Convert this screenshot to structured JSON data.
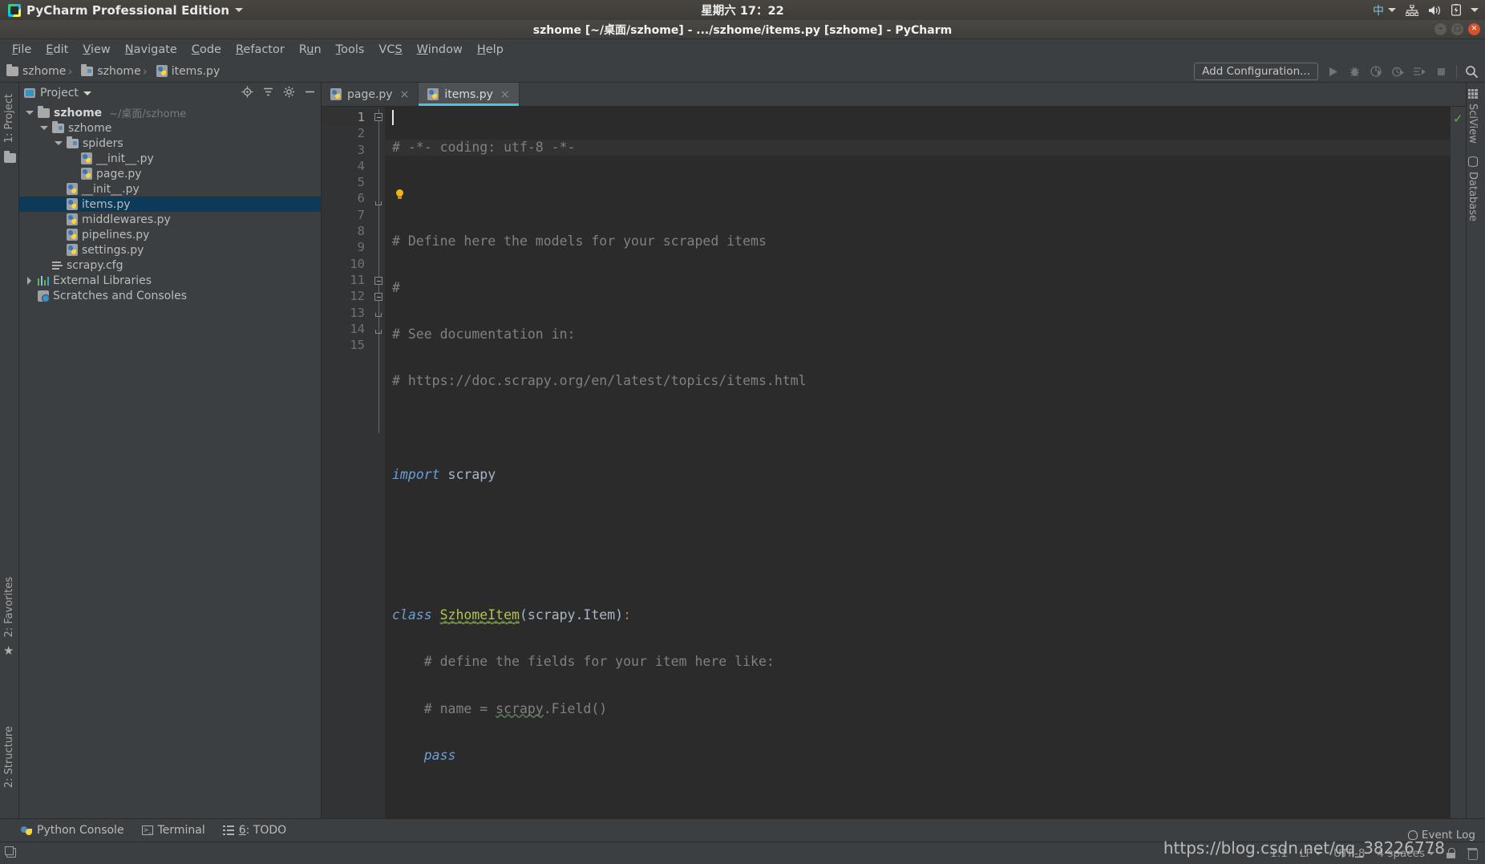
{
  "os_panel": {
    "app_name": "PyCharm Professional Edition",
    "clock": "星期六 17：22",
    "tray": {
      "input_method": "中",
      "icons": [
        "network-icon",
        "volume-icon",
        "battery-icon"
      ]
    }
  },
  "window": {
    "title": "szhome [~/桌面/szhome] - .../szhome/items.py [szhome] - PyCharm",
    "buttons": [
      "minimize",
      "maximize",
      "close"
    ]
  },
  "menubar": {
    "items": [
      {
        "label": "File",
        "mnemonic": "F"
      },
      {
        "label": "Edit",
        "mnemonic": "E"
      },
      {
        "label": "View",
        "mnemonic": "V"
      },
      {
        "label": "Navigate",
        "mnemonic": "N"
      },
      {
        "label": "Code",
        "mnemonic": "C"
      },
      {
        "label": "Refactor",
        "mnemonic": "R"
      },
      {
        "label": "Run",
        "mnemonic": "u"
      },
      {
        "label": "Tools",
        "mnemonic": "T"
      },
      {
        "label": "VCS",
        "mnemonic": "S"
      },
      {
        "label": "Window",
        "mnemonic": "W"
      },
      {
        "label": "Help",
        "mnemonic": "H"
      }
    ]
  },
  "breadcrumb": {
    "items": [
      {
        "label": "szhome",
        "icon": "folder-icon"
      },
      {
        "label": "szhome",
        "icon": "source-folder-icon"
      },
      {
        "label": "items.py",
        "icon": "python-file-icon"
      }
    ]
  },
  "toolbar": {
    "add_configuration": "Add Configuration...",
    "icons": [
      "run-icon",
      "debug-icon",
      "run-coverage-icon",
      "profile-icon",
      "run-with-console-icon",
      "stop-icon",
      "search-everywhere-icon"
    ]
  },
  "left_strip": {
    "top_label": "1: Project",
    "top_mnemonic": "1",
    "bottom_labels": [
      "2: Favorites",
      "2: Structure"
    ]
  },
  "right_strip": {
    "labels": [
      "SciView",
      "Database"
    ]
  },
  "project_panel": {
    "header": "Project",
    "actions": [
      "locate-icon",
      "collapse-all-icon",
      "settings-icon",
      "hide-icon"
    ],
    "tree": [
      {
        "label": "szhome",
        "path": "~/桌面/szhome",
        "icon": "folder-icon",
        "indent": 0,
        "twist": "open",
        "bold": true,
        "selected": false
      },
      {
        "label": "szhome",
        "path": "",
        "icon": "source-folder-icon",
        "indent": 1,
        "twist": "open",
        "bold": false,
        "selected": false
      },
      {
        "label": "spiders",
        "path": "",
        "icon": "source-folder-icon",
        "indent": 2,
        "twist": "open",
        "bold": false,
        "selected": false
      },
      {
        "label": "__init__.py",
        "path": "",
        "icon": "python-file-icon",
        "indent": 3,
        "twist": "none",
        "bold": false,
        "selected": false
      },
      {
        "label": "page.py",
        "path": "",
        "icon": "python-file-icon",
        "indent": 3,
        "twist": "none",
        "bold": false,
        "selected": false
      },
      {
        "label": "__init__.py",
        "path": "",
        "icon": "python-file-icon",
        "indent": 2,
        "twist": "none",
        "bold": false,
        "selected": false
      },
      {
        "label": "items.py",
        "path": "",
        "icon": "python-file-icon",
        "indent": 2,
        "twist": "none",
        "bold": false,
        "selected": true
      },
      {
        "label": "middlewares.py",
        "path": "",
        "icon": "python-file-icon",
        "indent": 2,
        "twist": "none",
        "bold": false,
        "selected": false
      },
      {
        "label": "pipelines.py",
        "path": "",
        "icon": "python-file-icon",
        "indent": 2,
        "twist": "none",
        "bold": false,
        "selected": false
      },
      {
        "label": "settings.py",
        "path": "",
        "icon": "python-file-icon",
        "indent": 2,
        "twist": "none",
        "bold": false,
        "selected": false
      },
      {
        "label": "scrapy.cfg",
        "path": "",
        "icon": "config-file-icon",
        "indent": 1,
        "twist": "none",
        "bold": false,
        "selected": false
      },
      {
        "label": "External Libraries",
        "path": "",
        "icon": "library-icon",
        "indent": 0,
        "twist": "closed",
        "bold": false,
        "selected": false
      },
      {
        "label": "Scratches and Consoles",
        "path": "",
        "icon": "scratch-icon",
        "indent": 0,
        "twist": "none",
        "bold": false,
        "selected": false
      }
    ]
  },
  "editor": {
    "tabs": [
      {
        "label": "page.py",
        "icon": "python-file-icon",
        "active": false
      },
      {
        "label": "items.py",
        "icon": "python-file-icon",
        "active": true
      }
    ],
    "close_glyph": "×",
    "inspection_status": "ok-check-icon",
    "lines": [
      {
        "n": "1",
        "text": "# -*- coding: utf-8 -*-"
      },
      {
        "n": "2",
        "text": ""
      },
      {
        "n": "3",
        "text": "# Define here the models for your scraped items"
      },
      {
        "n": "4",
        "text": "#"
      },
      {
        "n": "5",
        "text": "# See documentation in:"
      },
      {
        "n": "6",
        "text": "# https://doc.scrapy.org/en/latest/topics/items.html"
      },
      {
        "n": "7",
        "text": ""
      },
      {
        "n": "8",
        "text": "import scrapy"
      },
      {
        "n": "9",
        "text": ""
      },
      {
        "n": "10",
        "text": ""
      },
      {
        "n": "11",
        "text": "class SzhomeItem(scrapy.Item):"
      },
      {
        "n": "12",
        "text": "    # define the fields for your item here like:"
      },
      {
        "n": "13",
        "text": "    # name = scrapy.Field()"
      },
      {
        "n": "14",
        "text": "    pass"
      },
      {
        "n": "15",
        "text": ""
      }
    ]
  },
  "bottom_bar": {
    "items": [
      {
        "label": "Python Console",
        "icon": "python-console-icon",
        "mnemonic": ""
      },
      {
        "label": "Terminal",
        "icon": "terminal-icon",
        "mnemonic": ""
      },
      {
        "label": "6: TODO",
        "icon": "todo-icon",
        "mnemonic": "6"
      }
    ]
  },
  "statusbar": {
    "event_log": "Event Log",
    "caret_position": "1:1",
    "line_separator": "LF",
    "encoding": "UTF-8",
    "indent": "4 spaces",
    "watermark": "https://blog.csdn.net/qq_38226778"
  },
  "colors": {
    "accent_tab": "#4fc3d9",
    "selection": "#0d3a58",
    "editor_bg": "#2b2b2b",
    "panel_bg": "#3c3f41",
    "comment": "#808080",
    "keyword": "#6a9fd4",
    "class_name": "#b5c44c",
    "ok_green": "#62b543"
  }
}
